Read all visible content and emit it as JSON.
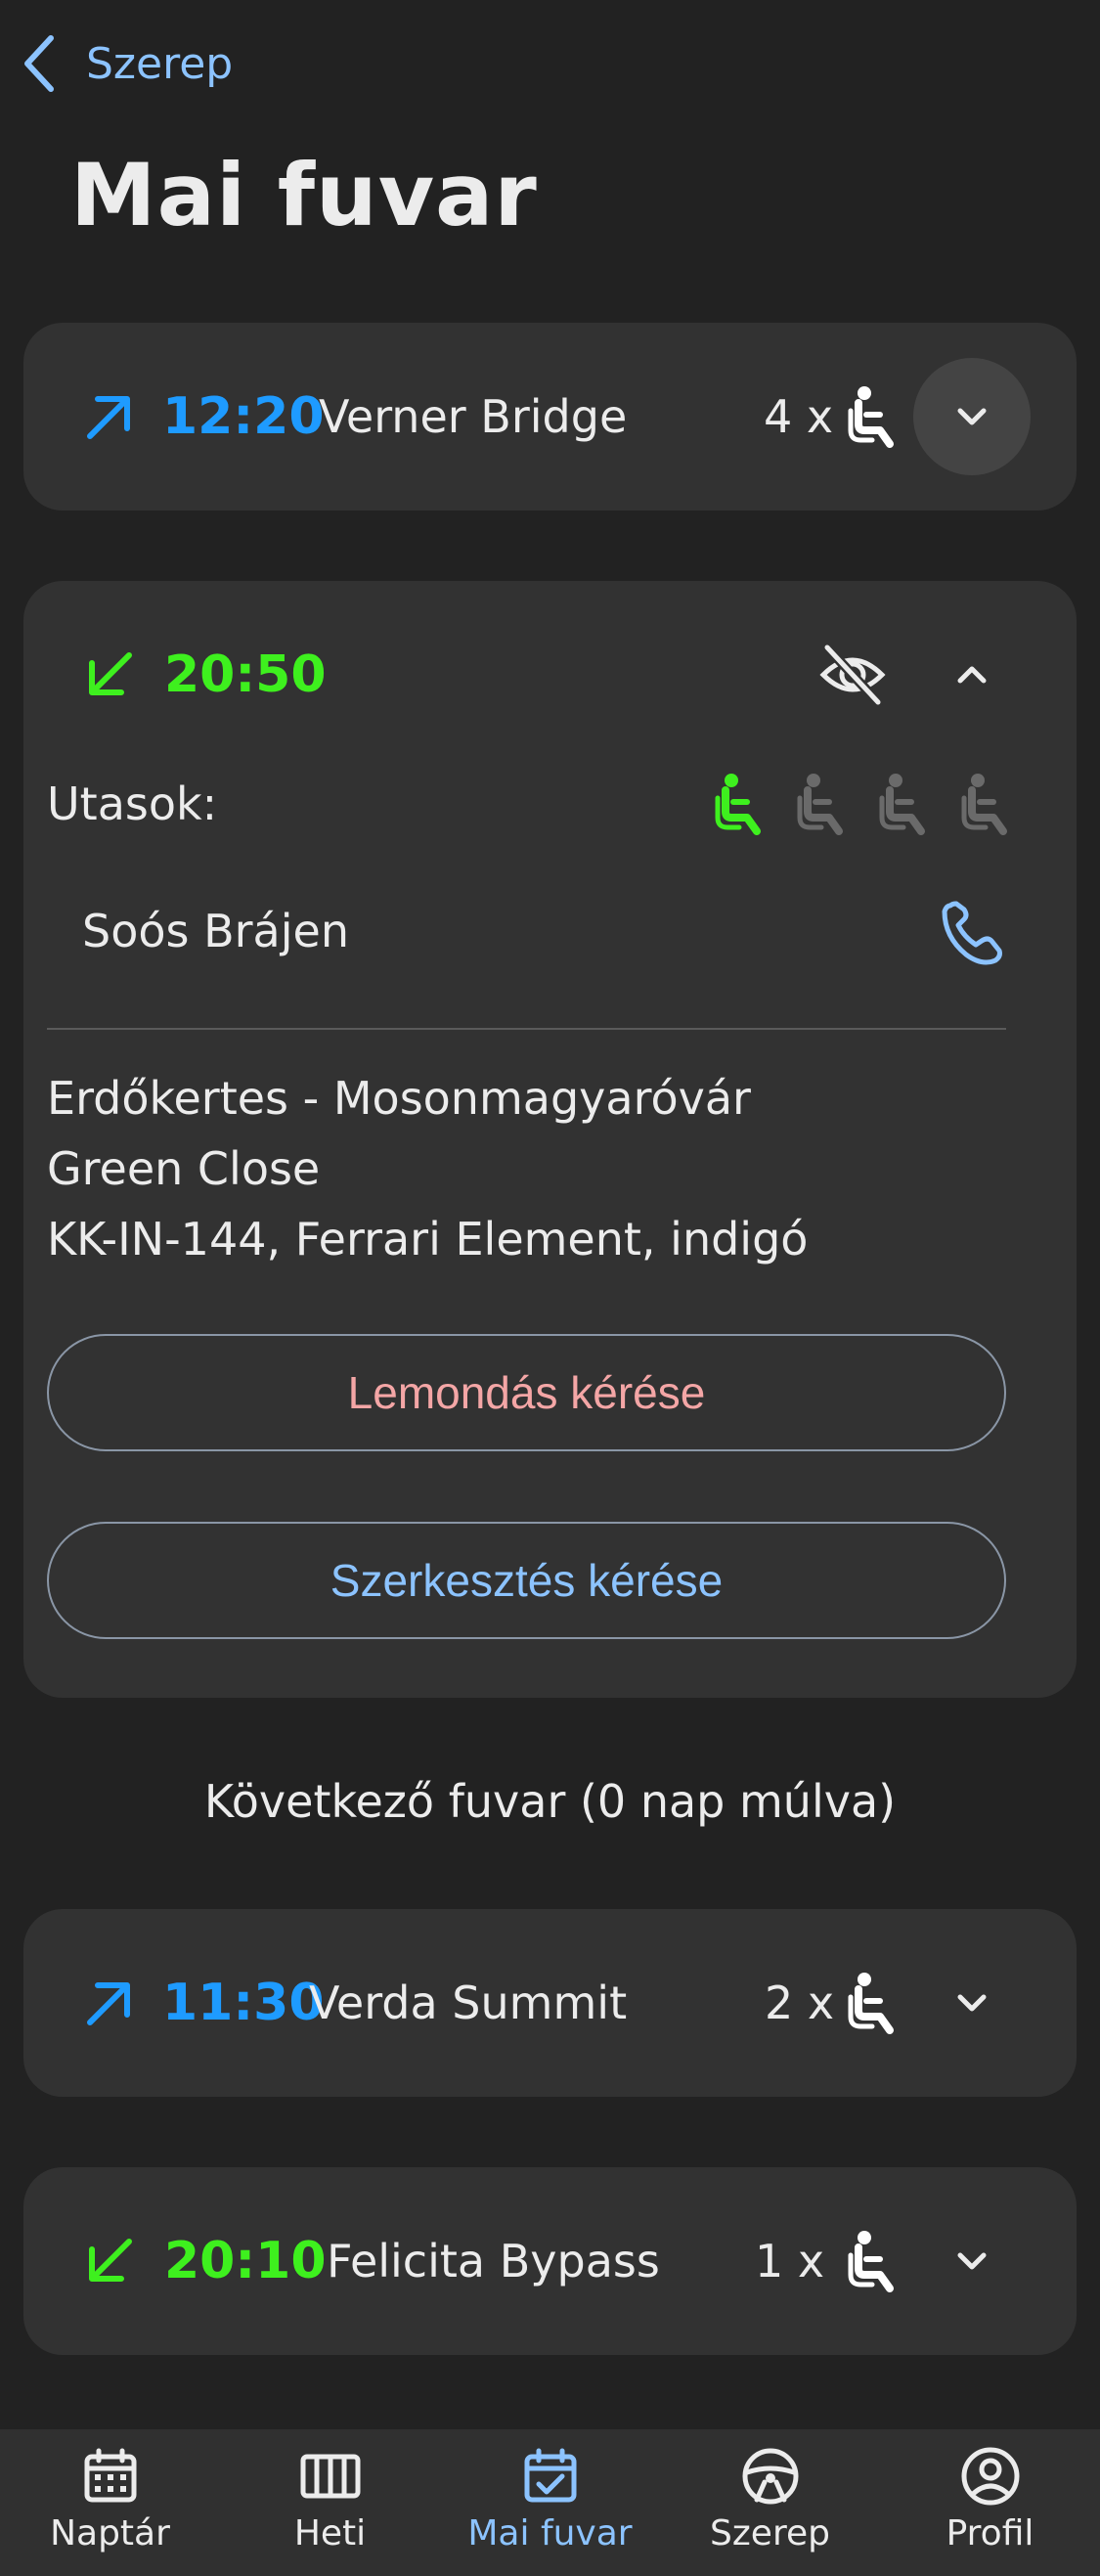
{
  "header": {
    "back_label": "Szerep",
    "title": "Mai fuvar"
  },
  "rides_today": [
    {
      "direction": "outbound",
      "time": "12:20",
      "destination": "Verner Bridge",
      "seats_label": "4 x",
      "expanded": false
    },
    {
      "direction": "inbound",
      "time": "20:50",
      "expanded": true,
      "passengers_label": "Utasok:",
      "seats_total": 4,
      "seats_taken": 1,
      "passenger_name": "Soós Brájen",
      "route": "Erdőkertes - Mosonmagyaróvár",
      "address": "Green Close",
      "vehicle": "KK-IN-144, Ferrari Element, indigó",
      "cancel_label": "Lemondás kérése",
      "edit_label": "Szerkesztés kérése"
    }
  ],
  "next_label": "Következő fuvar (0 nap múlva)",
  "rides_next": [
    {
      "direction": "outbound",
      "time": "11:30",
      "destination": "Verda Summit",
      "seats_label": "2 x"
    },
    {
      "direction": "inbound",
      "time": "20:10",
      "destination": "Felicita Bypass",
      "seats_label": "1 x"
    }
  ],
  "colors": {
    "outbound": "#1e9bff",
    "inbound": "#3ef01e",
    "accent": "#8cc3ff",
    "cancel": "#f4a6a6"
  },
  "bottom_nav": [
    {
      "label": "Naptár",
      "icon": "calendar-icon",
      "active": false
    },
    {
      "label": "Heti",
      "icon": "week-columns-icon",
      "active": false
    },
    {
      "label": "Mai fuvar",
      "icon": "calendar-check-icon",
      "active": true
    },
    {
      "label": "Szerep",
      "icon": "steering-wheel-icon",
      "active": false
    },
    {
      "label": "Profil",
      "icon": "account-circle-icon",
      "active": false
    }
  ]
}
